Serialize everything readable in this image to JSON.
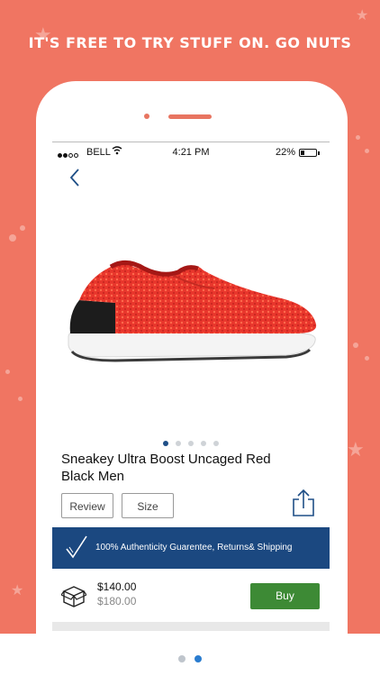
{
  "promo": {
    "headline": "IT'S FREE TO TRY STUFF ON. GO NUTS"
  },
  "status_bar": {
    "carrier": "BELL",
    "time": "4:21 PM",
    "battery": "22%"
  },
  "nav": {
    "back_icon": "chevron-left-icon"
  },
  "product": {
    "image": "red-sneaker",
    "title": "Sneakey Ultra Boost Uncaged Red Black Men",
    "image_pager_count": 5,
    "image_pager_active": 1
  },
  "actions": {
    "review_label": "Review",
    "size_label": "Size",
    "share_icon": "share-icon"
  },
  "banner": {
    "text": "100% Authenticity Guarentee, Returns& Shipping",
    "icon": "checkmark-icon"
  },
  "pricing": {
    "price": "$140.00",
    "original_price": "$180.00",
    "buy_label": "Buy",
    "box_icon": "box-icon"
  },
  "colors": {
    "background": "#f07562",
    "brand_blue": "#1b4880",
    "buy_green": "#3d8a35"
  },
  "onboarding_pager": {
    "count": 2,
    "active": 2
  }
}
